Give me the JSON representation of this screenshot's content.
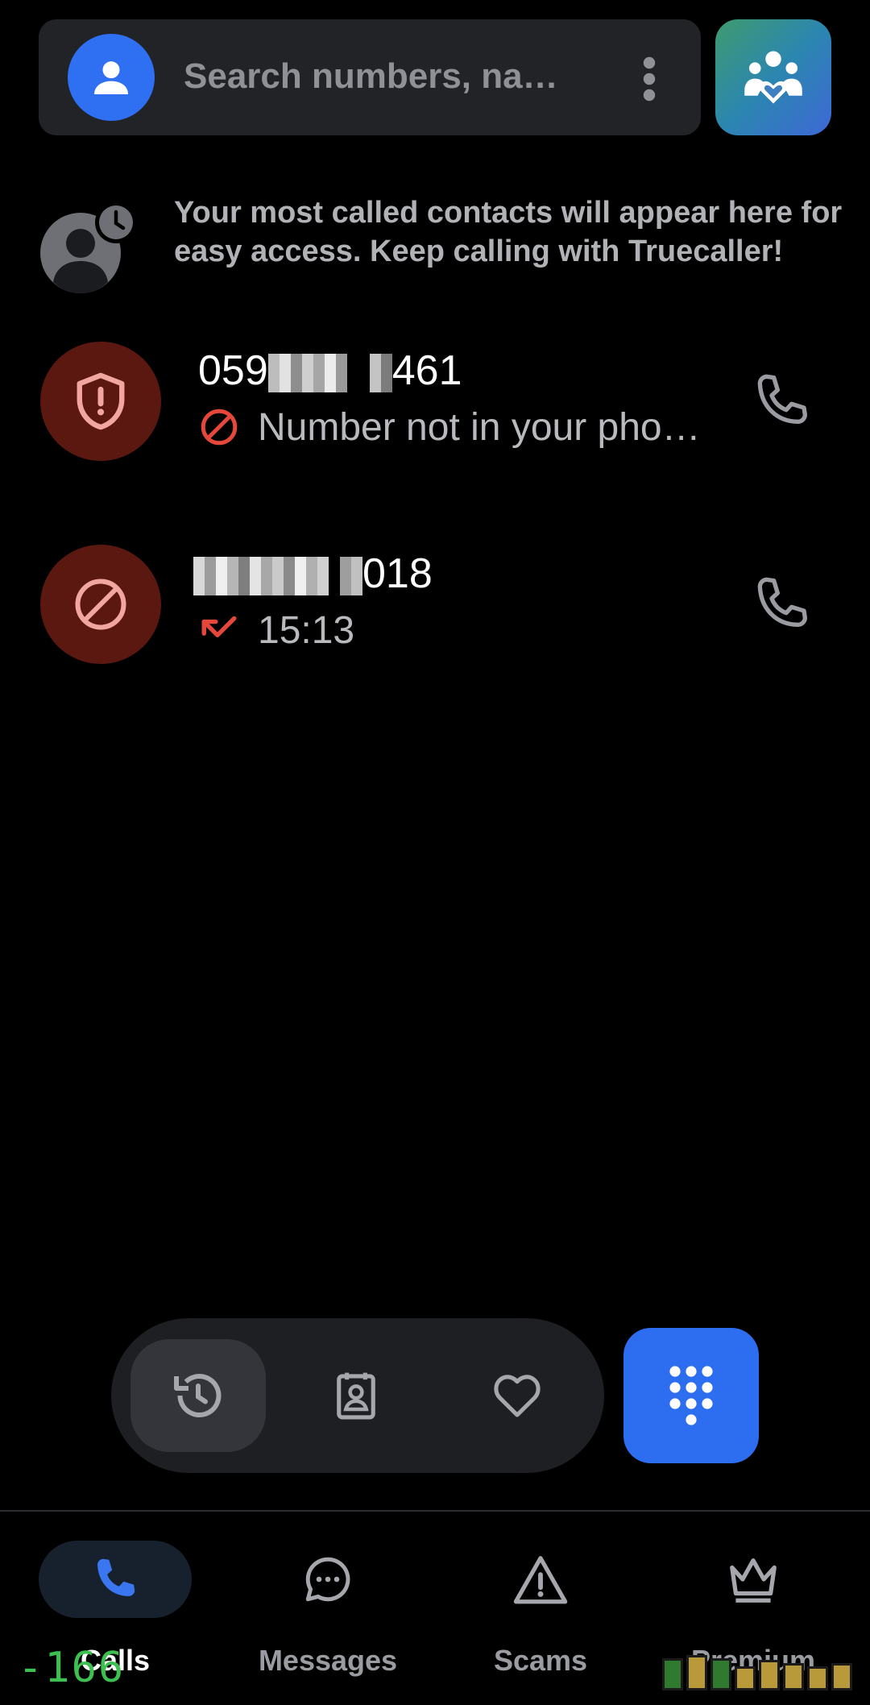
{
  "search": {
    "placeholder": "Search numbers, na…",
    "icons": {
      "avatar": "person-icon",
      "menu": "more-vert-icon",
      "family": "family-group-icon"
    }
  },
  "hint": {
    "text": "Your most called contacts will appear here for easy access. Keep calling with Truecaller!",
    "icon": "contact-history-icon"
  },
  "calls": [
    {
      "name_prefix": "059",
      "name_suffix": "461",
      "name_redacted": true,
      "subtitle": "Number not in your pho…",
      "avatar_icon": "shield-alert-icon",
      "subtitle_icon": "blocked-icon",
      "action_icon": "phone-icon"
    },
    {
      "name_prefix": "",
      "name_suffix": "018",
      "name_redacted": true,
      "subtitle": "15:13",
      "avatar_icon": "blocked-icon",
      "subtitle_icon": "missed-call-icon",
      "action_icon": "phone-icon"
    }
  ],
  "tabs": [
    {
      "name": "recents",
      "icon": "history-icon",
      "active": true
    },
    {
      "name": "contacts",
      "icon": "contact-card-icon",
      "active": false
    },
    {
      "name": "favorites",
      "icon": "heart-icon",
      "active": false
    }
  ],
  "dialpad": {
    "icon": "dialpad-icon"
  },
  "bottom_nav": [
    {
      "label": "Calls",
      "icon": "phone-icon",
      "active": true
    },
    {
      "label": "Messages",
      "icon": "chat-bubble-icon",
      "active": false
    },
    {
      "label": "Scams",
      "icon": "warning-icon",
      "active": false
    },
    {
      "label": "Premium",
      "icon": "crown-icon",
      "active": false
    }
  ],
  "overlay": {
    "counter": "-166"
  },
  "colors": {
    "background": "#000000",
    "search_bg": "#222326",
    "accent_blue": "#2f6ff2",
    "danger_avatar": "#5a1810",
    "danger_red": "#e5483a",
    "overlay_green": "#3ec050"
  }
}
